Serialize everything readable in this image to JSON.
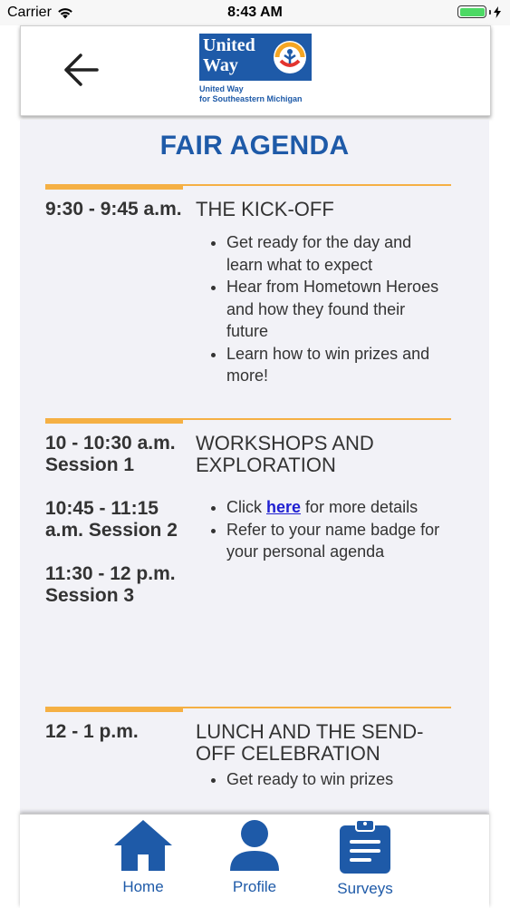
{
  "status_bar": {
    "carrier": "Carrier",
    "time": "8:43 AM"
  },
  "header": {
    "logo_line1": "United",
    "logo_line2": "Way",
    "logo_sub1": "United Way",
    "logo_sub2": "for Southeastern Michigan"
  },
  "page": {
    "title": "FAIR AGENDA"
  },
  "agenda": [
    {
      "times": [
        "9:30 - 9:45 a.m."
      ],
      "heading": "THE KICK-OFF",
      "bullets": [
        "Get ready for the day and learn what to expect",
        "Hear from Hometown Heroes and how they found their future",
        "Learn how to win prizes and more!"
      ]
    },
    {
      "times": [
        "10  - 10:30 a.m. Session 1",
        "10:45 - 11:15 a.m. Session 2",
        "11:30 - 12 p.m. Session 3"
      ],
      "heading": "WORKSHOPS AND EXPLORATION",
      "bullet1_pre": "Click ",
      "bullet1_link": "here",
      "bullet1_post": " for more details",
      "bullet2": "Refer to your name badge for your personal agenda"
    },
    {
      "times": [
        "12 - 1 p.m."
      ],
      "heading": "LUNCH AND THE SEND-OFF CELEBRATION",
      "bullets": [
        "Get ready to win prizes"
      ]
    }
  ],
  "tabs": [
    {
      "label": "Home",
      "icon": "home-icon"
    },
    {
      "label": "Profile",
      "icon": "profile-icon"
    },
    {
      "label": "Surveys",
      "icon": "clipboard-icon"
    }
  ],
  "colors": {
    "brand_blue": "#1e5aa8",
    "accent_orange": "#f5b044",
    "link_blue": "#1f1fd1"
  }
}
